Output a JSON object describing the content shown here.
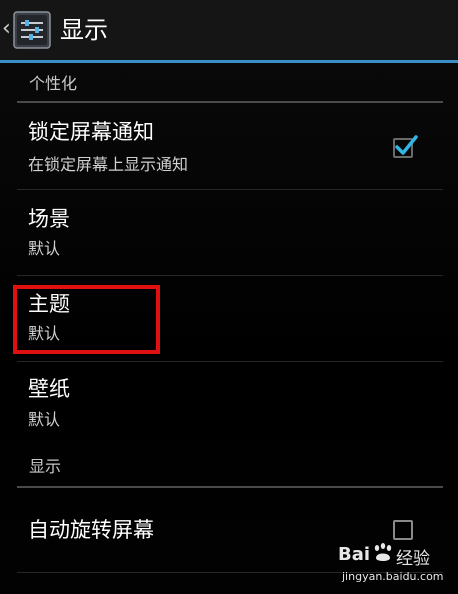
{
  "action_bar": {
    "title": "显示",
    "accent_color": "#3a8fc7",
    "icon": "display-settings-icon"
  },
  "sections": {
    "personalization": {
      "label": "个性化"
    },
    "display": {
      "label": "显示"
    }
  },
  "items": {
    "lockscreen_notifications": {
      "title": "锁定屏幕通知",
      "summary": "在锁定屏幕上显示通知",
      "checked": true
    },
    "scene": {
      "title": "场景",
      "summary": "默认"
    },
    "theme": {
      "title": "主题",
      "summary": "默认"
    },
    "wallpaper": {
      "title": "壁纸",
      "summary": "默认"
    },
    "auto_rotate": {
      "title": "自动旋转屏幕",
      "checked": false
    }
  },
  "annotation": {
    "highlight_color": "#e01010"
  },
  "watermark": {
    "logo_text": "Bai",
    "logo_text_2": "经验",
    "url": "jingyan.baidu.com"
  }
}
